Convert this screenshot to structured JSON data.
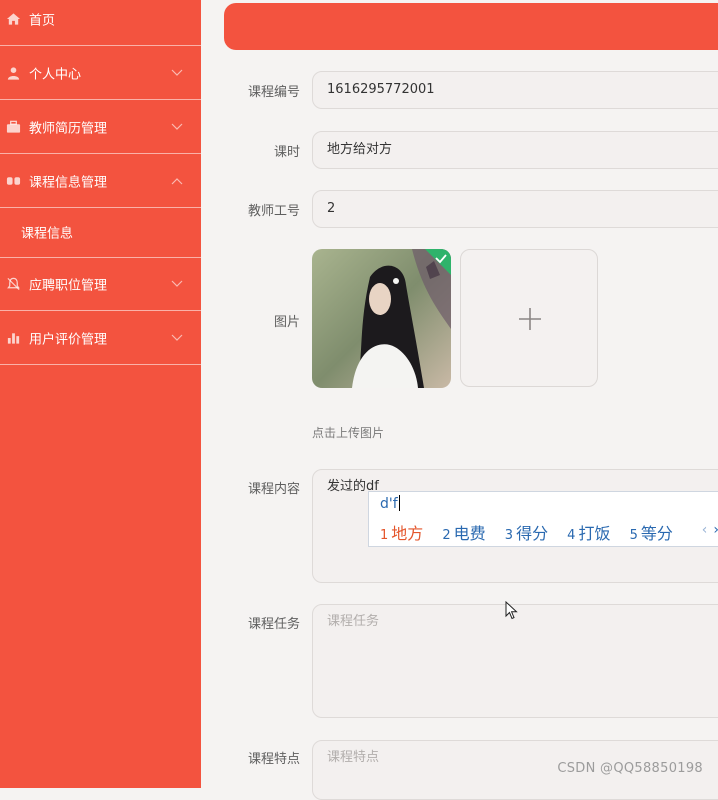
{
  "sidebar": {
    "items": [
      {
        "label": "首页",
        "icon": "home-icon"
      },
      {
        "label": "个人中心",
        "icon": "person-icon"
      },
      {
        "label": "教师简历管理",
        "icon": "briefcase-icon"
      },
      {
        "label": "课程信息管理",
        "icon": "chain-icon"
      },
      {
        "label": "应聘职位管理",
        "icon": "bell-icon"
      },
      {
        "label": "用户评价管理",
        "icon": "bar-chart-icon"
      }
    ],
    "sub_item": "课程信息"
  },
  "form": {
    "course_id_label": "课程编号",
    "course_id_value": "1616295772001",
    "hours_label": "课时",
    "hours_value": "地方给对方",
    "teacher_id_label": "教师工号",
    "teacher_id_value": "2",
    "image_label": "图片",
    "upload_hint": "点击上传图片",
    "content_label": "课程内容",
    "content_value": "发过的df",
    "task_label": "课程任务",
    "task_placeholder": "课程任务",
    "feature_label": "课程特点",
    "feature_placeholder": "课程特点"
  },
  "ime": {
    "composition": "d'f",
    "candidates": [
      {
        "num": "1",
        "text": "地方"
      },
      {
        "num": "2",
        "text": "电费"
      },
      {
        "num": "3",
        "text": "得分"
      },
      {
        "num": "4",
        "text": "打饭"
      },
      {
        "num": "5",
        "text": "等分"
      }
    ]
  },
  "watermark": "CSDN @QQ58850198",
  "colors": {
    "accent": "#f3533f",
    "ime_text": "#2a69b0",
    "ime_selected": "#e4552b"
  }
}
